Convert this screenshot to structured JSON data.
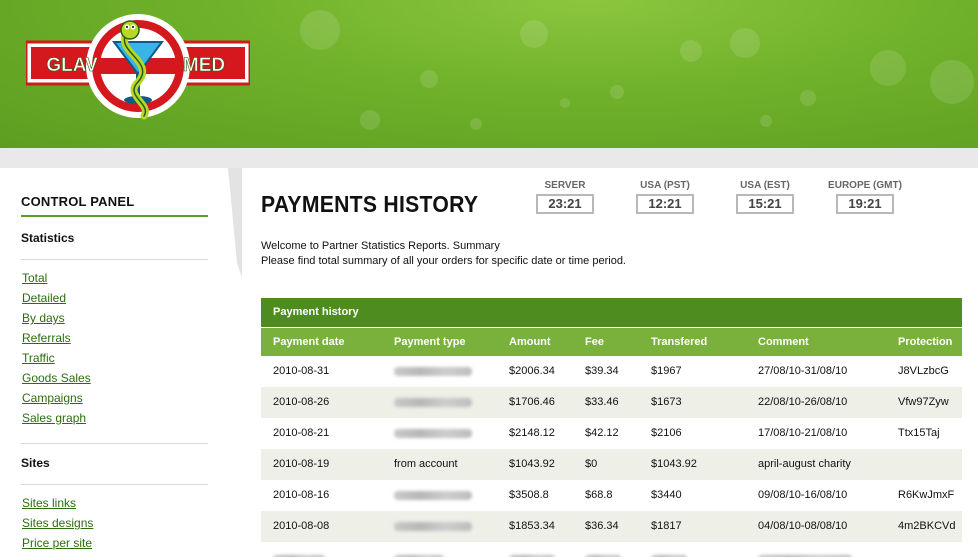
{
  "logo": {
    "left_text": "GLAV",
    "right_text": "MED"
  },
  "sidebar": {
    "title": "CONTROL PANEL",
    "statistics": {
      "title": "Statistics",
      "links": [
        "Total",
        "Detailed",
        "By days",
        "Referrals",
        "Traffic",
        "Goods Sales",
        "Campaigns",
        "Sales graph"
      ]
    },
    "sites": {
      "title": "Sites",
      "links": [
        "Sites links",
        "Sites designs",
        "Price per site"
      ]
    }
  },
  "main": {
    "title": "PAYMENTS HISTORY",
    "intro_line1": "Welcome to Partner Statistics Reports. Summary",
    "intro_line2": "Please find total summary of all your orders for specific date or time period."
  },
  "clocks": [
    {
      "label": "SERVER",
      "time": "23:21"
    },
    {
      "label": "USA (PST)",
      "time": "12:21"
    },
    {
      "label": "USA (EST)",
      "time": "15:21"
    },
    {
      "label": "EUROPE (GMT)",
      "time": "19:21"
    }
  ],
  "table": {
    "title": "Payment history",
    "columns": [
      "Payment date",
      "Payment type",
      "Amount",
      "Fee",
      "Transfered",
      "Comment",
      "Protection"
    ],
    "rows": [
      {
        "date": "2010-08-31",
        "type": "",
        "amount": "$2006.34",
        "fee": "$39.34",
        "transfered": "$1967",
        "comment": "27/08/10-31/08/10",
        "protection": "J8VLzbcG"
      },
      {
        "date": "2010-08-26",
        "type": "",
        "amount": "$1706.46",
        "fee": "$33.46",
        "transfered": "$1673",
        "comment": "22/08/10-26/08/10",
        "protection": "Vfw97Zyw"
      },
      {
        "date": "2010-08-21",
        "type": "",
        "amount": "$2148.12",
        "fee": "$42.12",
        "transfered": "$2106",
        "comment": "17/08/10-21/08/10",
        "protection": "Ttx15Taj"
      },
      {
        "date": "2010-08-19",
        "type": "from account",
        "amount": "$1043.92",
        "fee": "$0",
        "transfered": "$1043.92",
        "comment": "april-august charity",
        "protection": ""
      },
      {
        "date": "2010-08-16",
        "type": "",
        "amount": "$3508.8",
        "fee": "$68.8",
        "transfered": "$3440",
        "comment": "09/08/10-16/08/10",
        "protection": "R6KwJmxF"
      },
      {
        "date": "2010-08-08",
        "type": "",
        "amount": "$1853.34",
        "fee": "$36.34",
        "transfered": "$1817",
        "comment": "04/08/10-08/08/10",
        "protection": "4m2BKCVd"
      }
    ]
  },
  "colors": {
    "brand_green": "#6fb12a",
    "table_title": "#4e8c1f",
    "table_head": "#79b13c",
    "link": "#2c6e0f"
  }
}
